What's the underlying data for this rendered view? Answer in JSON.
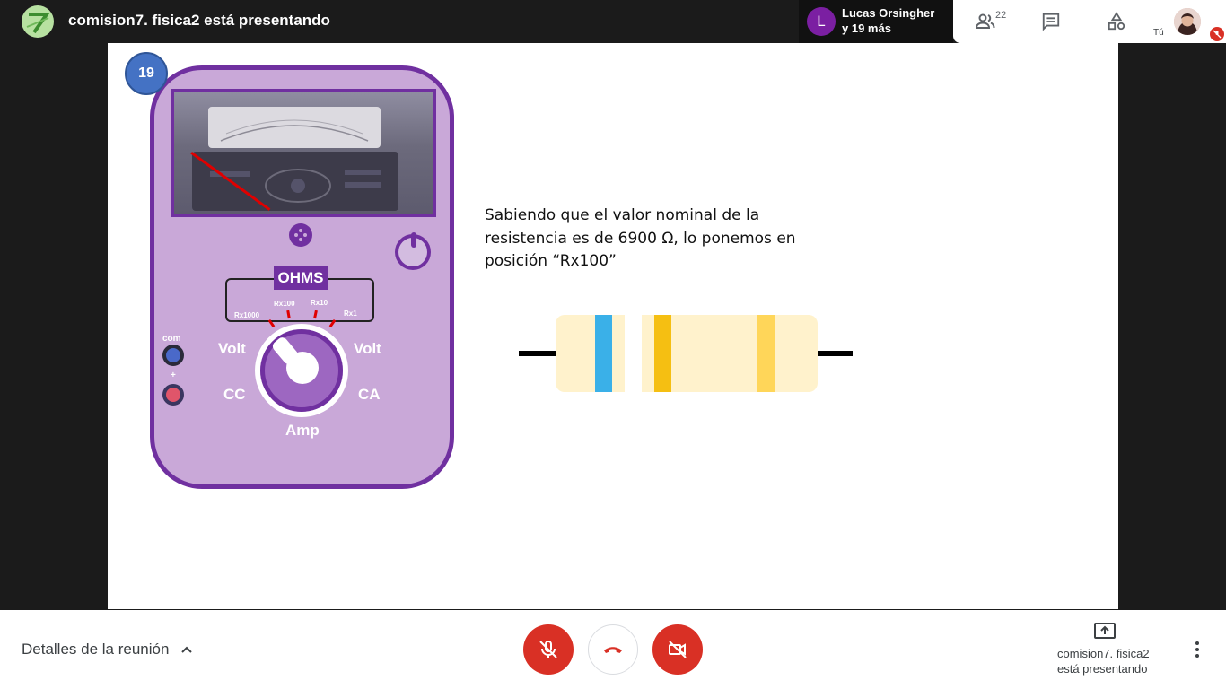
{
  "header": {
    "title": "comision7. fisica2 está presentando",
    "participants_chip": {
      "avatar_letter": "L",
      "line1": "Lucas Orsingher",
      "line2": "y 19 más"
    },
    "people_count": "22",
    "self_label": "Tú"
  },
  "slide": {
    "slide_number": "19",
    "meter": {
      "ohms_label": "OHMS",
      "ticks": [
        "Rx1000",
        "Rx100",
        "Rx10",
        "Rx1"
      ],
      "volt_left": "Volt",
      "volt_right": "Volt",
      "cc": "CC",
      "ca": "CA",
      "amp": "Amp",
      "com": "com",
      "plus": "+"
    },
    "text_line1": "Sabiendo que el valor nominal de la",
    "text_line2": "resistencia es de 6900 Ω, lo ponemos en",
    "text_line3": "posición “Rx100”",
    "resistor_bands": [
      "#3ab0e8",
      "#ffffff",
      "#f5bf12",
      "#ffd659"
    ]
  },
  "footer": {
    "details_label": "Detalles de la reunión",
    "presenting_line1": "comision7. fisica2",
    "presenting_line2": "está presentando"
  },
  "colors": {
    "accent_red": "#d93025",
    "meter_purple": "#7030a0",
    "meter_fill": "#c9a8d8"
  }
}
